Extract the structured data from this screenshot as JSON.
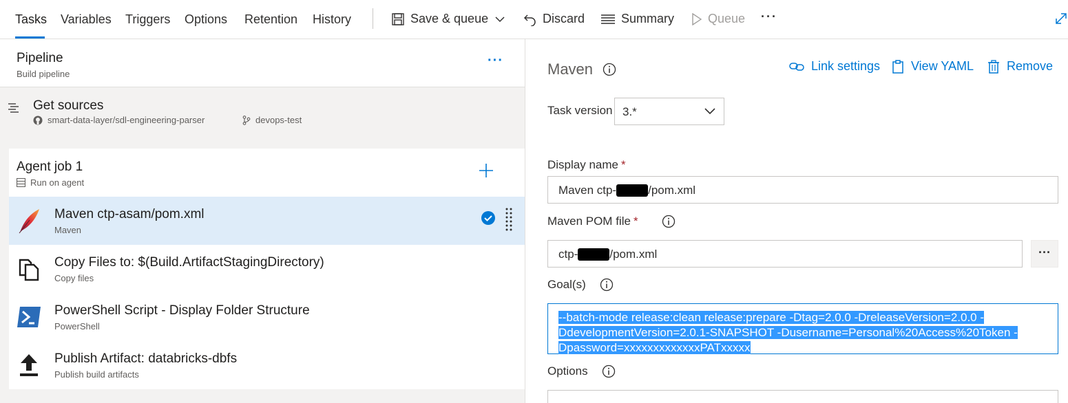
{
  "tabs": [
    {
      "label": "Tasks",
      "active": true
    },
    {
      "label": "Variables"
    },
    {
      "label": "Triggers"
    },
    {
      "label": "Options"
    },
    {
      "label": "Retention"
    },
    {
      "label": "History"
    }
  ],
  "toolbar": {
    "save_queue": "Save & queue",
    "discard": "Discard",
    "summary": "Summary",
    "queue": "Queue",
    "more": "···"
  },
  "pipeline": {
    "title": "Pipeline",
    "subtitle": "Build pipeline",
    "more": "···"
  },
  "get_sources": {
    "title": "Get sources",
    "repo": "smart-data-layer/sdl-engineering-parser",
    "branch": "devops-test"
  },
  "agent_job": {
    "title": "Agent job 1",
    "subtitle": "Run on agent"
  },
  "tasks": [
    {
      "title": "Maven ctp-asam/pom.xml",
      "subtitle": "Maven",
      "icon": "maven-feather-icon",
      "selected": true
    },
    {
      "title": "Copy Files to: $(Build.ArtifactStagingDirectory)",
      "subtitle": "Copy files",
      "icon": "copy-files-icon"
    },
    {
      "title": "PowerShell Script - Display Folder Structure",
      "subtitle": "PowerShell",
      "icon": "powershell-icon"
    },
    {
      "title": "Publish Artifact: databricks-dbfs",
      "subtitle": "Publish build artifacts",
      "icon": "publish-upload-icon"
    }
  ],
  "detail": {
    "title": "Maven",
    "link_settings": "Link settings",
    "view_yaml": "View YAML",
    "remove": "Remove",
    "task_version_label": "Task version",
    "task_version_value": "3.*",
    "display_name_label": "Display name",
    "display_name_prefix": "Maven ctp-",
    "display_name_suffix": "/pom.xml",
    "pom_label": "Maven POM file",
    "pom_prefix": "ctp-",
    "pom_suffix": "/pom.xml",
    "browse": "···",
    "goals_label": "Goal(s)",
    "goals_value": "--batch-mode release:clean release:prepare -Dtag=2.0.0 -DreleaseVersion=2.0.0 -DdevelopmentVersion=2.0.1-SNAPSHOT -Dusername=Personal%20Access%20Token -Dpassword=xxxxxxxxxxxxxPATxxxxx",
    "options_label": "Options",
    "required_mark": "*"
  },
  "colors": {
    "accent": "#0078d4",
    "selected_row": "#deecf9",
    "selection_highlight": "#3399ff",
    "required": "#a4262c"
  }
}
